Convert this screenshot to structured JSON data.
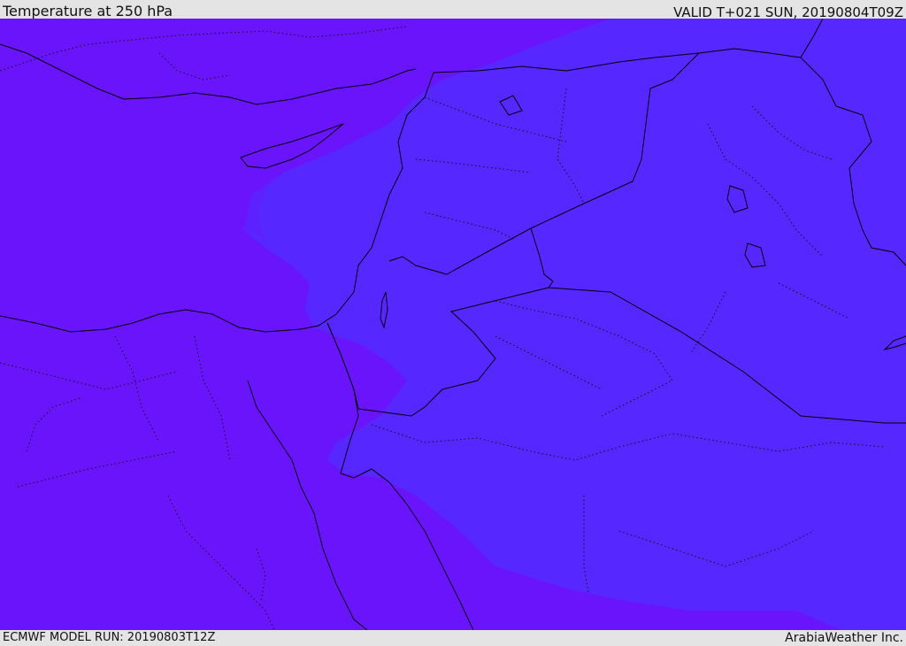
{
  "header": {
    "title": "Temperature at 250 hPa",
    "valid_time": "VALID T+021 SUN, 20190804T09Z"
  },
  "footer": {
    "model_run": "ECMWF MODEL RUN: 20190803T12Z",
    "credit": "ArabiaWeather Inc."
  },
  "map": {
    "field": "temperature",
    "level": "250 hPa",
    "colors": {
      "warm_shade": "#6a14fb",
      "cool_shade": "#5727ff",
      "coastline": "#000000",
      "border": "#000000"
    }
  }
}
